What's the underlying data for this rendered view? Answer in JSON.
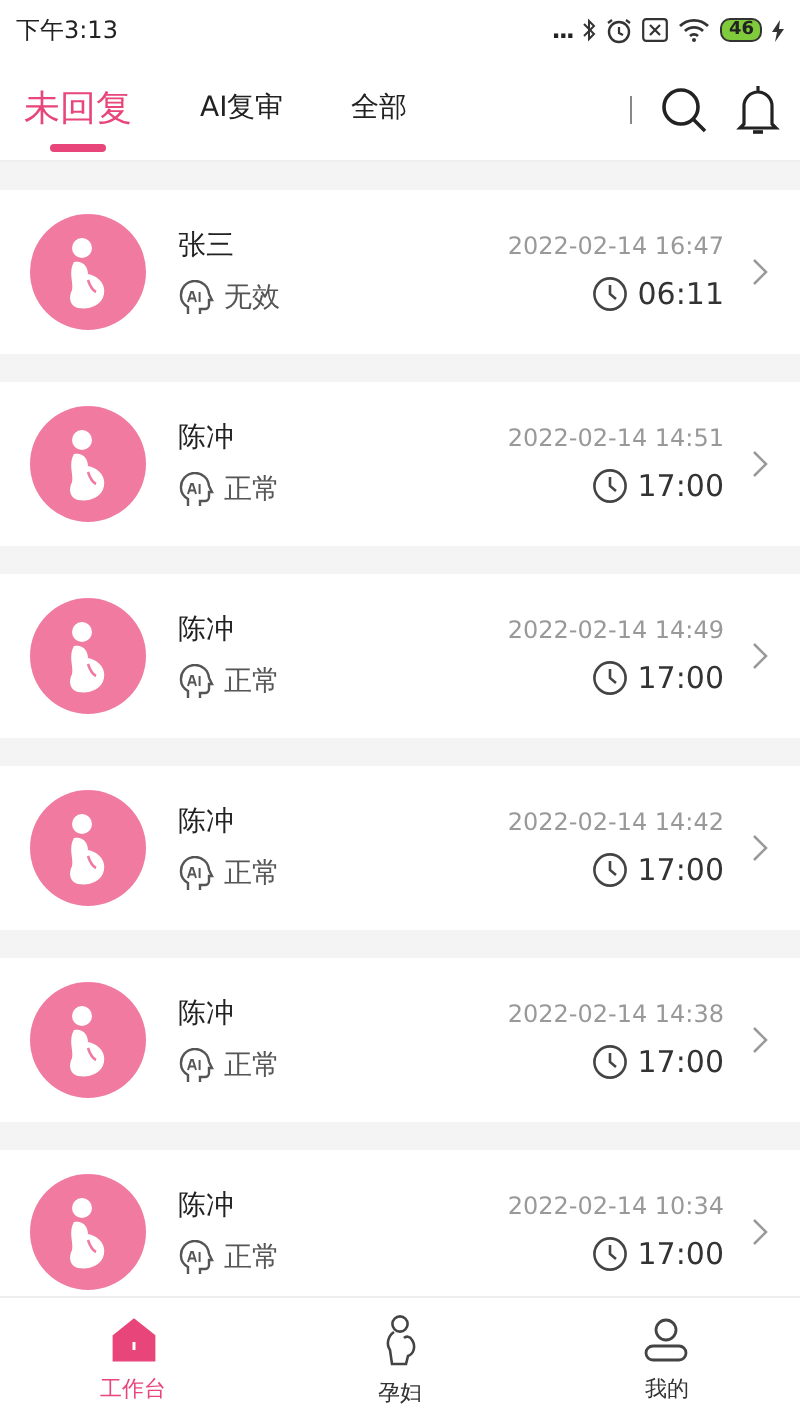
{
  "status_bar": {
    "time": "下午3:13",
    "dots": "...",
    "battery": "46"
  },
  "tabs": [
    {
      "label": "未回复",
      "selected": true
    },
    {
      "label": "AI复审",
      "selected": false
    },
    {
      "label": "全部",
      "selected": false
    }
  ],
  "records": [
    {
      "name": "张三",
      "datetime": "2022-02-14 16:47",
      "result": "无效",
      "duration": "06:11"
    },
    {
      "name": "陈冲",
      "datetime": "2022-02-14 14:51",
      "result": "正常",
      "duration": "17:00"
    },
    {
      "name": "陈冲",
      "datetime": "2022-02-14 14:49",
      "result": "正常",
      "duration": "17:00"
    },
    {
      "name": "陈冲",
      "datetime": "2022-02-14 14:42",
      "result": "正常",
      "duration": "17:00"
    },
    {
      "name": "陈冲",
      "datetime": "2022-02-14 14:38",
      "result": "正常",
      "duration": "17:00"
    },
    {
      "name": "陈冲",
      "datetime": "2022-02-14 10:34",
      "result": "正常",
      "duration": "17:00"
    }
  ],
  "bottom_nav": [
    {
      "kind": "home",
      "label": "工作台",
      "selected": true
    },
    {
      "kind": "pregnant",
      "label": "孕妇",
      "selected": false
    },
    {
      "kind": "user",
      "label": "我的",
      "selected": false
    }
  ]
}
